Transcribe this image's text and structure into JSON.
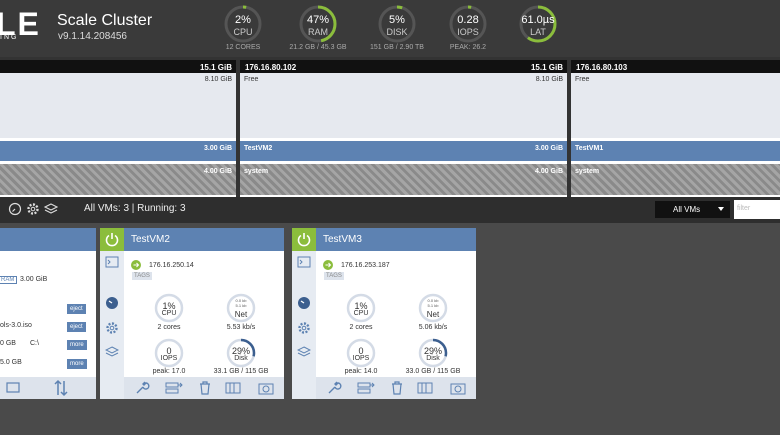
{
  "header": {
    "logo_text": "LE",
    "logo_sub": "ING",
    "cluster_name": "Scale Cluster",
    "version": "v9.1.14.208456"
  },
  "gauges": [
    {
      "value": "2%",
      "name": "CPU",
      "sub": "12 CORES",
      "level": 0.02
    },
    {
      "value": "47%",
      "name": "RAM",
      "sub": "21.2 GB / 45.3 GB",
      "level": 0.47
    },
    {
      "value": "5%",
      "name": "DISK",
      "sub": "151 GB / 2.90 TB",
      "level": 0.05
    },
    {
      "value": "0.28",
      "name": "IOPS",
      "sub": "PEAK: 26.2",
      "level": 0.03
    },
    {
      "value": "61.0µs",
      "name": "LAT",
      "sub": "",
      "level": 0.6
    }
  ],
  "nodes": [
    {
      "ip": "",
      "total": "15.1 GiB",
      "free_label": "",
      "free": "8.10 GiB",
      "vm_label": "",
      "vm_mem": "3.00 GiB",
      "sys_label": "",
      "sys_mem": "4.00 GiB"
    },
    {
      "ip": "176.16.80.102",
      "total": "15.1 GiB",
      "free_label": "Free",
      "free": "8.10 GiB",
      "vm_label": "TestVM2",
      "vm_mem": "3.00 GiB",
      "sys_label": "system",
      "sys_mem": "4.00 GiB"
    },
    {
      "ip": "176.16.80.103",
      "total": "",
      "free_label": "Free",
      "free": "",
      "vm_label": "TestVM1",
      "vm_mem": "",
      "sys_label": "system",
      "sys_mem": ""
    }
  ],
  "toolbar": {
    "vm_count": "All VMs: 3 | Running: 3",
    "filter_select": "All VMs",
    "filter_placeholder": "filter"
  },
  "partial_card": {
    "ram_badge": "RAM",
    "ram_value": "3.00 GiB",
    "iso": "ols-3.0.iso",
    "disk_size": "0 GB",
    "disk_drive": "C:\\",
    "disk2": "5.0 GB",
    "btn_eject": "eject",
    "btn_more": "more"
  },
  "cards": [
    {
      "name": "TestVM2",
      "ip": "176.16.250.14",
      "tags": "TAGS",
      "cpu": "1%",
      "cpu_label": "CPU",
      "cores": "2 cores",
      "net_up": "0.0 kb",
      "net_down": "5.1 kb",
      "net_label": "Net",
      "net_rate": "5.53 kb/s",
      "iops": "0",
      "iops_label": "IOPS",
      "peak": "peak: 17.0",
      "disk": "29%",
      "disk_label": "Disk",
      "disk_usage": "33.1 GB / 115 GB"
    },
    {
      "name": "TestVM3",
      "ip": "176.16.253.187",
      "tags": "TAGS",
      "cpu": "1%",
      "cpu_label": "CPU",
      "cores": "2 cores",
      "net_up": "0.0 kb",
      "net_down": "5.1 kb",
      "net_label": "Net",
      "net_rate": "5.06 kb/s",
      "iops": "0",
      "iops_label": "IOPS",
      "peak": "peak: 14.0",
      "disk": "29%",
      "disk_label": "Disk",
      "disk_usage": "33.0 GB / 115 GB"
    }
  ],
  "colors": {
    "accent": "#5d82b2",
    "power": "#8bbd3c",
    "gauge_ring": "#8bbd3c"
  }
}
